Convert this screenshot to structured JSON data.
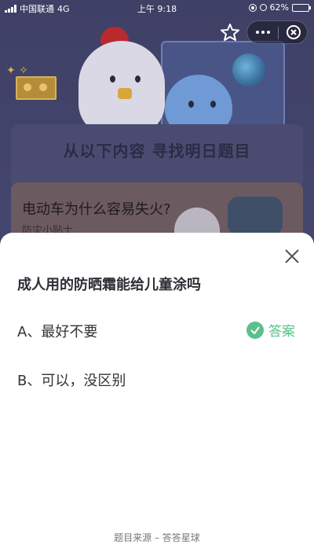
{
  "status_bar": {
    "carrier": "中国联通",
    "network": "4G",
    "time": "上午 9:18",
    "battery": "62%",
    "battery_level": 0.62
  },
  "background": {
    "headline": "从以下内容  寻找明日题目",
    "card_question": "电动车为什么容易失火?",
    "card_sub": "防灾小贴士"
  },
  "quiz": {
    "question": "成人用的防晒霜能给儿童涂吗",
    "options": [
      {
        "label": "A、最好不要",
        "is_answer": true
      },
      {
        "label": "B、可以，没区别",
        "is_answer": false
      }
    ],
    "answer_label": "答案",
    "source": "题目来源 – 答答星球"
  },
  "colors": {
    "accent_green": "#5bc08a",
    "sheet_bg": "#ffffff",
    "question_text": "#2e2e36"
  },
  "icons": [
    "star-icon",
    "more-dots-icon",
    "close-circle-icon",
    "close-icon",
    "check-circle-icon"
  ]
}
